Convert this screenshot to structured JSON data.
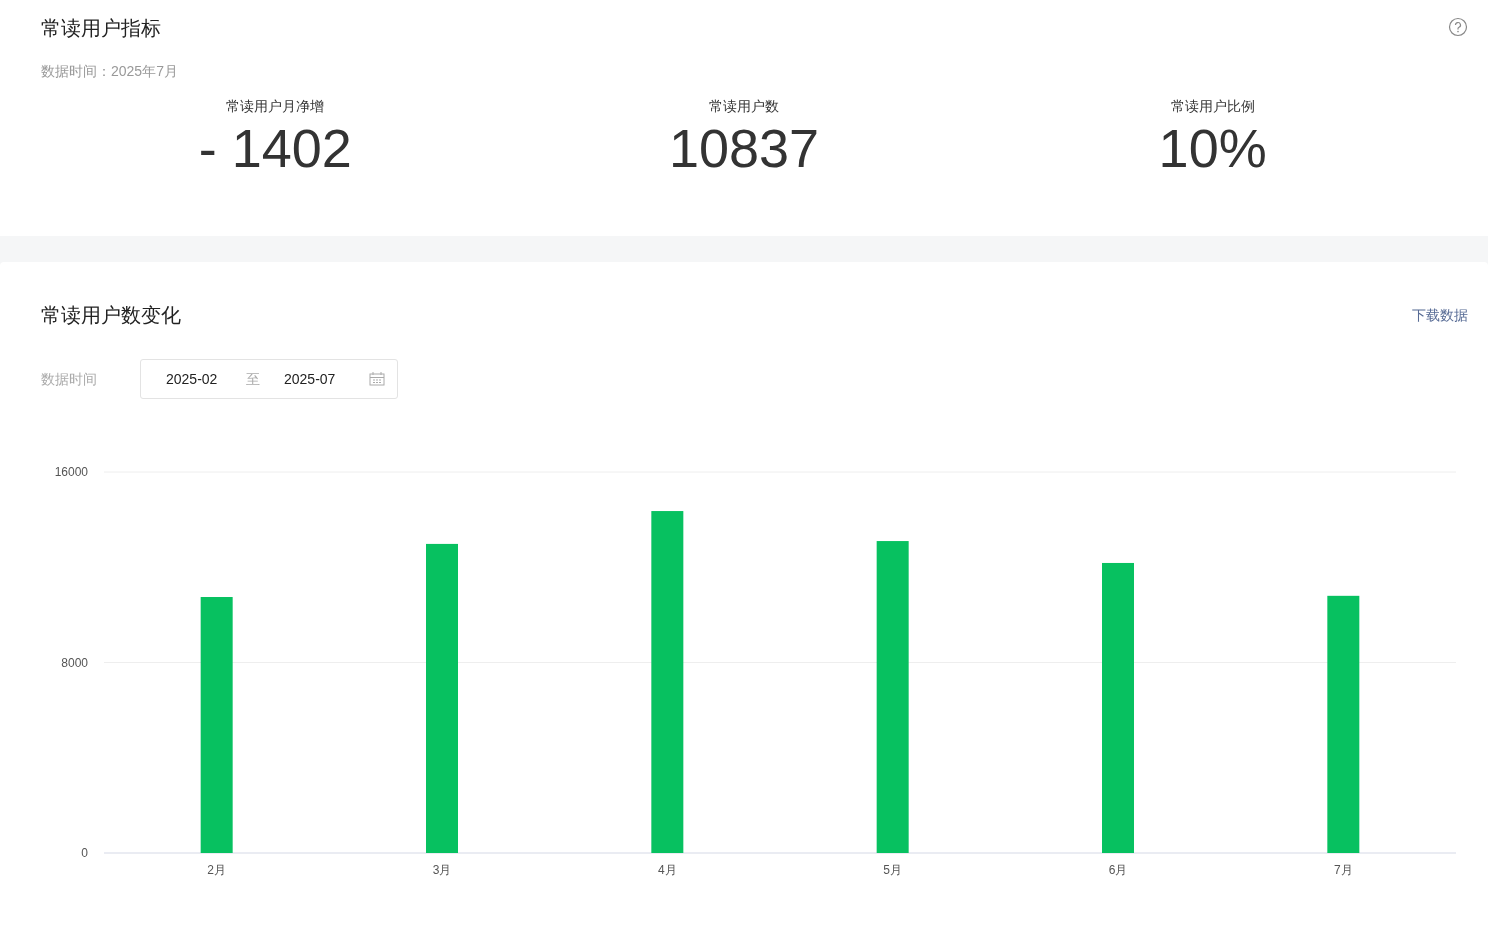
{
  "metrics_card": {
    "title": "常读用户指标",
    "data_time": "数据时间：2025年7月",
    "metrics": [
      {
        "label": "常读用户月净增",
        "value": "- 1402"
      },
      {
        "label": "常读用户数",
        "value": "10837"
      },
      {
        "label": "常读用户比例",
        "value": "10%"
      }
    ]
  },
  "trend_card": {
    "title": "常读用户数变化",
    "download_link": "下载数据",
    "date_filter": {
      "label": "数据时间",
      "start": "2025-02",
      "separator": "至",
      "end": "2025-07"
    },
    "chart_data": {
      "type": "bar",
      "categories": [
        "2月",
        "3月",
        "4月",
        "5月",
        "6月",
        "7月"
      ],
      "series": [
        {
          "color": "#07c160",
          "values": [
            10750,
            12980,
            14360,
            13100,
            12180,
            10800
          ]
        }
      ],
      "ylim": [
        0,
        16000
      ],
      "yticks": [
        0,
        8000,
        16000
      ]
    }
  }
}
